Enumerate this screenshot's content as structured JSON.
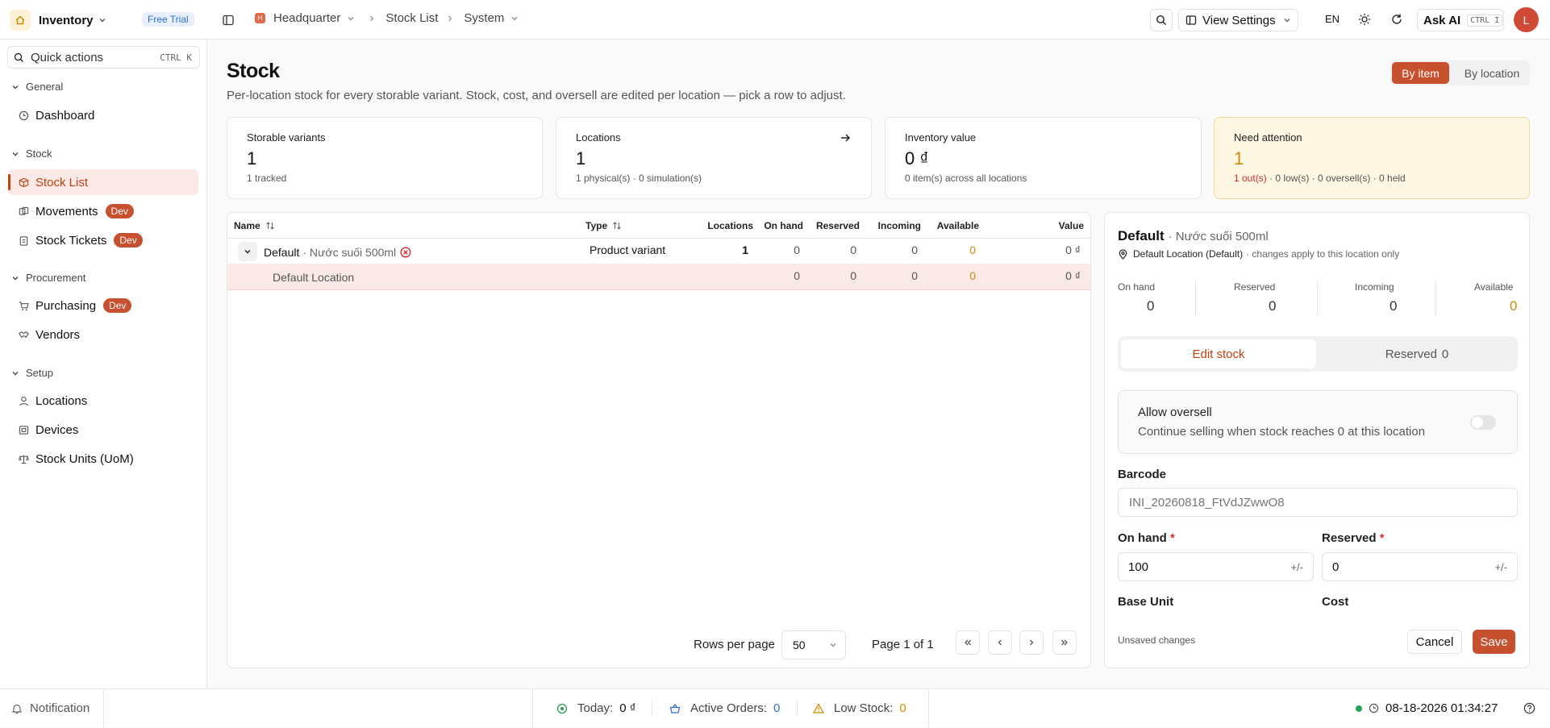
{
  "topbar": {
    "app_name": "Inventory",
    "trial_badge": "Free Trial",
    "breadcrumb": {
      "org": "Headquarter",
      "page": "Stock List",
      "scope": "System"
    },
    "view_settings": "View Settings",
    "language": "EN",
    "ask_ai": "Ask AI",
    "ask_ai_shortcut": "CTRL I",
    "avatar_letter": "L",
    "org_logo_letter": "H"
  },
  "sidebar": {
    "quick_actions": "Quick actions",
    "quick_actions_shortcut": "CTRL K",
    "sections": {
      "general": "General",
      "stock": "Stock",
      "procurement": "Procurement",
      "setup": "Setup"
    },
    "items": {
      "dashboard": "Dashboard",
      "stock_list": "Stock List",
      "movements": "Movements",
      "stock_tickets": "Stock Tickets",
      "purchasing": "Purchasing",
      "vendors": "Vendors",
      "locations": "Locations",
      "devices": "Devices",
      "stock_units": "Stock Units (UoM)"
    },
    "dev_badge": "Dev"
  },
  "page": {
    "title": "Stock",
    "subtitle": "Per-location stock for every storable variant. Stock, cost, and oversell are edited per location — pick a row to adjust.",
    "toggle_by_item": "By item",
    "toggle_by_location": "By location"
  },
  "stats": [
    {
      "label": "Storable variants",
      "value": "1",
      "sub": "1 tracked"
    },
    {
      "label": "Locations",
      "value": "1",
      "sub": "1 physical(s) · 0 simulation(s)"
    },
    {
      "label": "Inventory value",
      "value": "0 ₫",
      "sub": "0 item(s) across all locations"
    },
    {
      "label": "Need attention",
      "value": "1",
      "sub_out": "1 out(s)",
      "sub_rest": " · 0 low(s) · 0 oversell(s) · 0 held"
    }
  ],
  "table": {
    "headers": {
      "name": "Name",
      "type": "Type",
      "locations": "Locations",
      "on_hand": "On hand",
      "reserved": "Reserved",
      "incoming": "Incoming",
      "available": "Available",
      "value": "Value"
    },
    "row": {
      "name": "Default",
      "variant": "· Nước suối 500ml",
      "type": "Product variant",
      "locations": "1",
      "on_hand": "0",
      "reserved": "0",
      "incoming": "0",
      "available": "0",
      "value": "0 ₫"
    },
    "subrow": {
      "name": "Default Location",
      "on_hand": "0",
      "reserved": "0",
      "incoming": "0",
      "available": "0",
      "value": "0 ₫"
    },
    "rows_per_page_label": "Rows per page",
    "rows_per_page": "50",
    "page_info": "Page 1 of 1"
  },
  "detail": {
    "title": "Default",
    "variant": "· Nước suối 500ml",
    "location": "Default Location (Default)",
    "location_note": "· changes apply to this location only",
    "metrics": [
      {
        "label": "On hand",
        "value": "0"
      },
      {
        "label": "Reserved",
        "value": "0"
      },
      {
        "label": "Incoming",
        "value": "0"
      },
      {
        "label": "Available",
        "value": "0"
      }
    ],
    "tab_edit": "Edit stock",
    "tab_reserved": "Reserved",
    "tab_reserved_count": "0",
    "oversell_title": "Allow oversell",
    "oversell_desc": "Continue selling when stock reaches 0 at this location",
    "oversell_enabled": false,
    "barcode_label": "Barcode",
    "barcode_placeholder": "INI_20260818_FtVdJZwwO8",
    "on_hand_label": "On hand",
    "on_hand_value": "100",
    "reserved_label": "Reserved",
    "reserved_value": "0",
    "adjust_suffix": "+/-",
    "required_mark": "*",
    "base_unit_label": "Base Unit",
    "cost_label": "Cost",
    "unsaved": "Unsaved changes",
    "cancel": "Cancel",
    "save": "Save"
  },
  "bottombar": {
    "notification": "Notification",
    "today_label": "Today:",
    "today_value": "0 ₫",
    "orders_label": "Active Orders:",
    "orders_value": "0",
    "low_label": "Low Stock:",
    "low_value": "0",
    "datetime": "08-18-2026 01:34:27"
  },
  "colors": {
    "accent": "#c7502e",
    "warning": "#d18a00",
    "danger": "#d22d2d",
    "info": "#2d6fd2"
  }
}
